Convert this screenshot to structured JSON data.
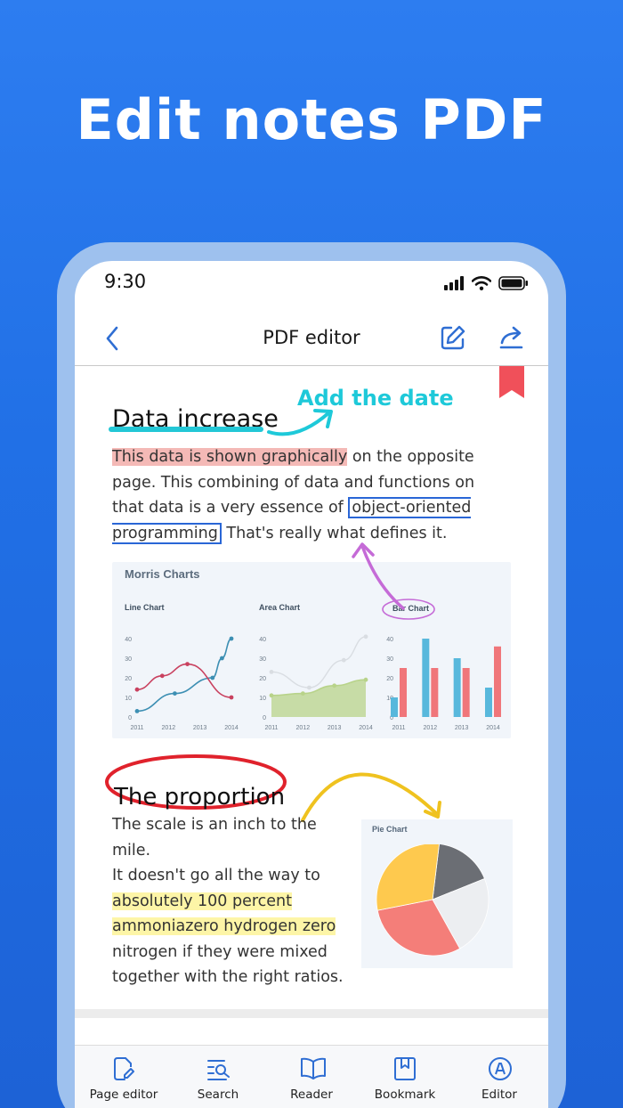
{
  "headline": "Edit notes PDF",
  "status": {
    "time": "9:30"
  },
  "navbar": {
    "title": "PDF editor"
  },
  "document": {
    "heading1": "Data increase",
    "annotation_note": "Add the date",
    "para1": {
      "highlight": "This data is shown graphically",
      "after_highlight": " on the opposite page. This combining of data and functions on that data is a very essence of ",
      "boxed": "object-oriented programming",
      "after_boxed": " That's really what defines it."
    },
    "charts_title": "Morris Charts",
    "heading2": "The proportion",
    "para2": {
      "line1": "The scale is an inch to the mile.",
      "line2": "It doesn't go all the way to",
      "highlight1": "absolutely 100 percent",
      "highlight2": "ammoniazero hydrogen zero",
      "line5": "nitrogen if they were mixed",
      "line6": "together with the right ratios."
    }
  },
  "chart_data": [
    {
      "type": "line",
      "title": "Line Chart",
      "categories": [
        "2011",
        "2012",
        "2013",
        "2014"
      ],
      "ylim": [
        0,
        40
      ],
      "yticks": [
        "0",
        "10",
        "20",
        "30",
        "40"
      ],
      "series": [
        {
          "color": "#3d8fb3",
          "x": [
            2011,
            2012.2,
            2013.4,
            2013.7,
            2014
          ],
          "values": [
            3,
            12,
            20,
            30,
            40
          ]
        },
        {
          "color": "#c9415f",
          "x": [
            2011,
            2011.8,
            2012.6,
            2014
          ],
          "values": [
            14,
            21,
            27,
            10
          ]
        }
      ]
    },
    {
      "type": "area",
      "title": "Area Chart",
      "categories": [
        "2011",
        "2012",
        "2013",
        "2014"
      ],
      "ylim": [
        0,
        40
      ],
      "yticks": [
        "0",
        "10",
        "20",
        "30",
        "40"
      ],
      "series": [
        {
          "color": "#d9dde2",
          "x": [
            2011,
            2012.2,
            2013.3,
            2014
          ],
          "values": [
            23,
            15,
            29,
            41
          ]
        },
        {
          "color": "#b8d38a",
          "x": [
            2011,
            2012,
            2013,
            2014
          ],
          "values": [
            11,
            12,
            16,
            19
          ]
        }
      ]
    },
    {
      "type": "bar",
      "title": "Bar Chart",
      "categories": [
        "2011",
        "2012",
        "2013",
        "2014"
      ],
      "ylim": [
        0,
        40
      ],
      "yticks": [
        "0",
        "10",
        "20",
        "30",
        "40"
      ],
      "series": [
        {
          "color": "#58b8dc",
          "values": [
            10,
            40,
            30,
            15
          ]
        },
        {
          "color": "#f0767a",
          "values": [
            25,
            25,
            25,
            36
          ]
        }
      ]
    },
    {
      "type": "pie",
      "title": "Pie Chart",
      "series": [
        {
          "color": "#6b6e74",
          "values": [
            17
          ]
        },
        {
          "color": "#eceef1",
          "values": [
            23
          ]
        },
        {
          "color": "#f47e79",
          "values": [
            30
          ]
        },
        {
          "color": "#fec94e",
          "values": [
            30
          ]
        }
      ]
    }
  ],
  "tabbar": {
    "items": [
      {
        "label": "Page editor",
        "icon": "page-edit-icon"
      },
      {
        "label": "Search",
        "icon": "search-list-icon"
      },
      {
        "label": "Reader",
        "icon": "book-icon"
      },
      {
        "label": "Bookmark",
        "icon": "bookmark-icon"
      },
      {
        "label": "Editor",
        "icon": "editor-icon"
      }
    ],
    "accent": "#2f6ed3"
  }
}
